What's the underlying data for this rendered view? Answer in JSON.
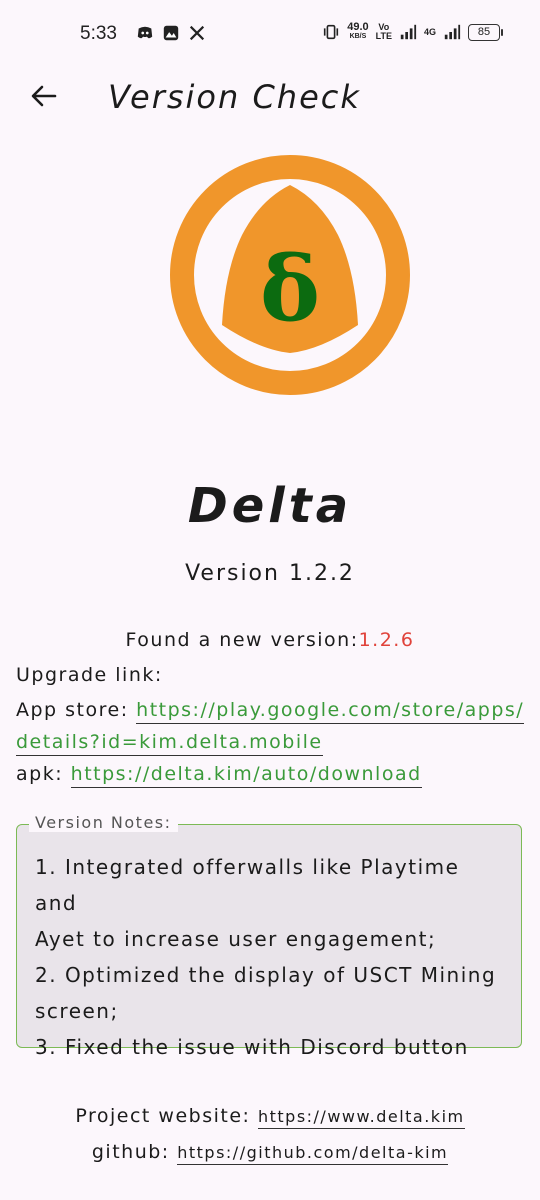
{
  "status_bar": {
    "time": "5:33",
    "net_speed": "49.0",
    "net_speed_unit": "KB/S",
    "volte_top": "Vo",
    "volte_bottom": "LTE",
    "network_type": "4G",
    "battery": "85"
  },
  "app_bar": {
    "back_icon": "back-arrow-icon",
    "title": "Version Check"
  },
  "logo": {
    "glyph": "δ",
    "ring_color": "#f0962b",
    "glyph_color": "#0c6b10"
  },
  "app": {
    "name": "Delta",
    "version": "Version 1.2.2"
  },
  "update": {
    "found_label": "Found a new version:",
    "new_version": "1.2.6",
    "upgrade_label": "Upgrade link:",
    "appstore_label": "App store: ",
    "appstore_url_line1": "https://play.google.com/store/apps/",
    "appstore_url_line2": "details?id=kim.delta.mobile",
    "apk_label": "apk: ",
    "apk_url": "https://delta.kim/auto/download"
  },
  "notes": {
    "legend": "Version Notes:",
    "line1": "1. Integrated offerwalls like Playtime and",
    "line2": "Ayet to increase user engagement;",
    "line3": "2. Optimized the display of USCT Mining",
    "line4": "screen;",
    "line5": "3. Fixed the issue with Discord button"
  },
  "footer": {
    "website_label": "Project website: ",
    "website_url": "https://www.delta.kim",
    "github_label": "github: ",
    "github_url": "https://github.com/delta-kim"
  },
  "colors": {
    "background": "#fcf7fc",
    "link_green": "#3a9a3a",
    "accent_red": "#e0423a",
    "notes_border": "#7cba55",
    "notes_bg": "#e9e4ea"
  }
}
